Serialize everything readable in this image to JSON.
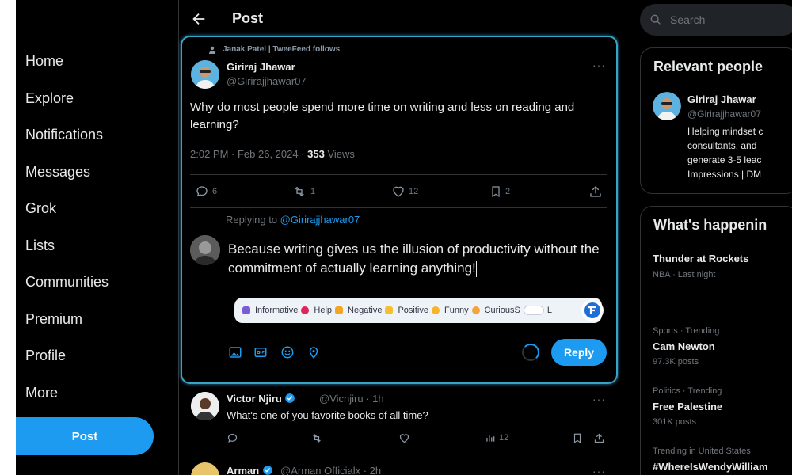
{
  "colors": {
    "accent": "#1d9bf0",
    "background": "#000000",
    "muted": "#71767b",
    "text": "#e7e9ea"
  },
  "sidebar": {
    "items": [
      {
        "label": "Home"
      },
      {
        "label": "Explore"
      },
      {
        "label": "Notifications"
      },
      {
        "label": "Messages"
      },
      {
        "label": "Grok"
      },
      {
        "label": "Lists"
      },
      {
        "label": "Communities"
      },
      {
        "label": "Premium"
      },
      {
        "label": "Profile"
      },
      {
        "label": "More"
      }
    ],
    "post_button": "Post"
  },
  "header": {
    "title": "Post",
    "back_icon": "arrow-left-icon"
  },
  "tweet": {
    "social_context": "Janak Patel | TweeFeed follows",
    "author_name": "Giriraj Jhawar",
    "author_handle": "@Girirajjhawar07",
    "text": "Why do most people spend more time on writing and less on reading and learning?",
    "time": "2:02 PM · Feb 26, 2024 · ",
    "views_count": "353",
    "views_label": " Views",
    "replies": "6",
    "reposts": "1",
    "likes": "12",
    "bookmarks": "2"
  },
  "composer": {
    "replying_prefix": "Replying to ",
    "replying_handle": "@Girirajjhawar07",
    "draft_text": "Because writing gives us the illusion of productivity without the commitment of actually learning anything!",
    "extension_options": [
      "Informative",
      "Help",
      "Negative",
      "Positive",
      "Funny",
      "CuriousS"
    ],
    "extension_toggle_label": "L",
    "reply_button": "Reply"
  },
  "replies": [
    {
      "name": "Victor Njiru",
      "handle": "@Vicnjiru · 1h",
      "text": "What's one of you favorite books of all time?",
      "views": "12"
    },
    {
      "name": "Arman",
      "handle": "@Arman Officialx · 2h"
    }
  ],
  "right": {
    "search_placeholder": "Search",
    "relevant_title": "Relevant people",
    "relevant_person": {
      "name": "Giriraj Jhawar",
      "handle": "@Girirajjhawar07",
      "bio_lines": [
        "Helping mindset c",
        "consultants, and",
        "generate 3-5 leac",
        "Impressions | DM"
      ]
    },
    "happening_title": "What's happenin",
    "trends": [
      {
        "context": "",
        "name": "Thunder at Rockets",
        "count": "NBA · Last night"
      },
      {
        "context": "Sports · Trending",
        "name": "Cam Newton",
        "count": "97.3K posts"
      },
      {
        "context": "Politics · Trending",
        "name": "Free Palestine",
        "count": "301K posts"
      },
      {
        "context": "Trending in United States",
        "name": "#WhereIsWendyWilliam",
        "count": ""
      }
    ]
  }
}
